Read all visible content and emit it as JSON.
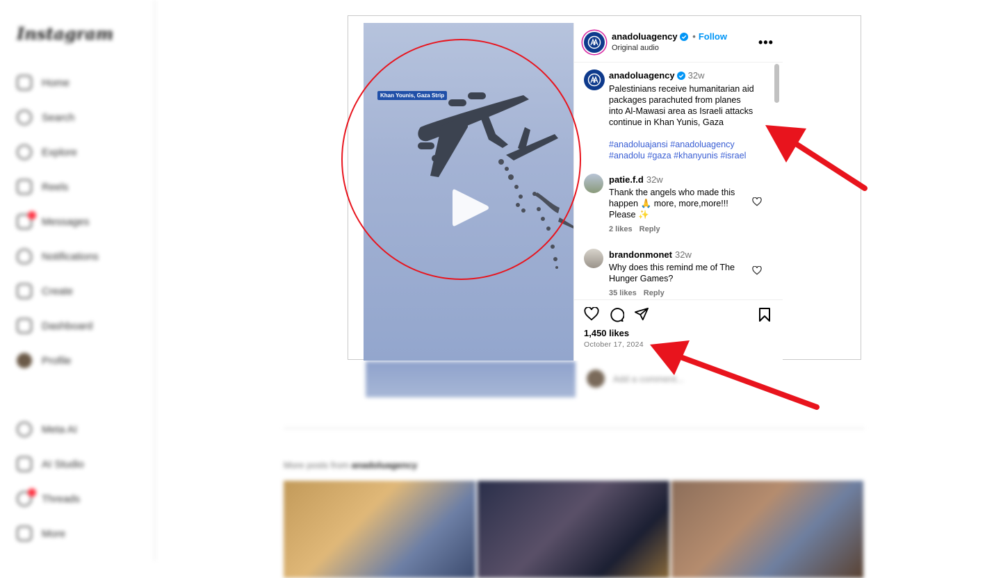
{
  "app": {
    "logo_text": "Instagram"
  },
  "sidebar": {
    "items": [
      {
        "label": "Home"
      },
      {
        "label": "Search"
      },
      {
        "label": "Explore"
      },
      {
        "label": "Reels"
      },
      {
        "label": "Messages"
      },
      {
        "label": "Notifications"
      },
      {
        "label": "Create"
      },
      {
        "label": "Dashboard"
      },
      {
        "label": "Profile"
      }
    ],
    "bottom_items": [
      {
        "label": "Meta AI"
      },
      {
        "label": "AI Studio"
      },
      {
        "label": "Threads"
      },
      {
        "label": "More"
      }
    ]
  },
  "post": {
    "media": {
      "location_tag": "Khan Younis, Gaza Strip"
    },
    "header": {
      "username": "anadoluagency",
      "separator": "•",
      "follow_label": "Follow",
      "subtitle": "Original audio",
      "more_label": "•••"
    },
    "caption": {
      "username": "anadoluagency",
      "time": "32w",
      "text_lines": [
        "Palestinians receive humanitarian aid",
        "packages parachuted from planes",
        "into Al-Mawasi area as Israeli attacks",
        "continue in Khan Yunis, Gaza"
      ],
      "hashtag_lines": [
        "#anadoluajansi #anadoluagency",
        "#anadolu #gaza #khanyunis #israel"
      ]
    },
    "comments": [
      {
        "username": "patie.f.d",
        "time": "32w",
        "text_lines": [
          "Thank the angels who made this",
          "happen 🙏 more, more,more!!!",
          "Please ✨"
        ],
        "likes": "2 likes",
        "reply": "Reply"
      },
      {
        "username": "brandonmonet",
        "time": "32w",
        "text_lines": [
          "Why does this remind me of The",
          "Hunger Games?"
        ],
        "likes": "35 likes",
        "reply": "Reply"
      }
    ],
    "likes_count": "1,450 likes",
    "date": "October 17, 2024"
  },
  "background": {
    "comment_placeholder": "Add a comment...",
    "more_posts_prefix": "More posts from",
    "more_posts_user": "anadoluagency"
  },
  "colors": {
    "annotation_red": "#e8141d",
    "link_blue": "#0095f6",
    "hashtag_blue": "#385dd3",
    "notification_red": "#ff3040"
  }
}
